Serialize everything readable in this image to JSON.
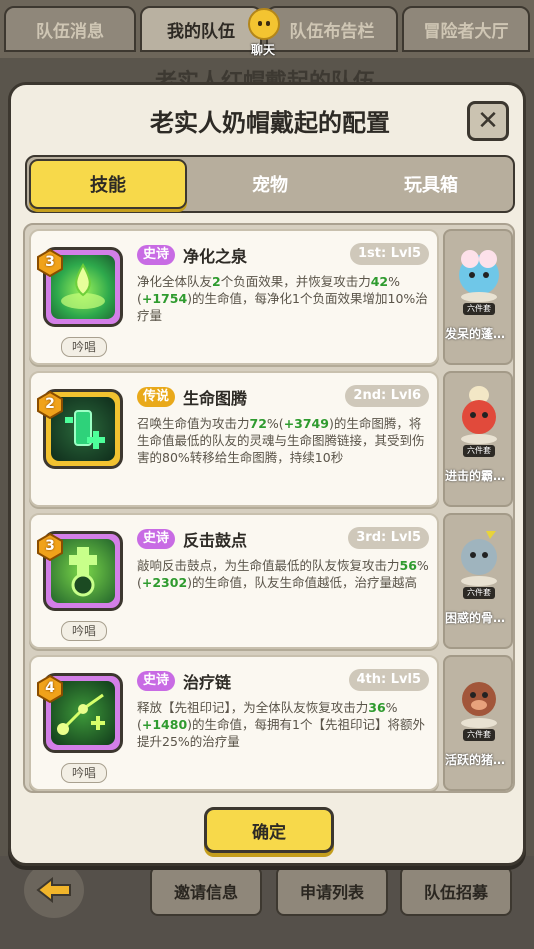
{
  "top_tabs": [
    "队伍消息",
    "我的队伍",
    "队伍布告栏",
    "冒险者大厅"
  ],
  "chat_label": "聊天",
  "background_title": "老实人红帽戴起的队伍",
  "modal": {
    "title": "老实人奶帽戴起的配置",
    "close_symbol": "✕",
    "tabs": [
      "技能",
      "宠物",
      "玩具箱"
    ],
    "active_tab": "技能",
    "confirm_label": "确定"
  },
  "skills": [
    {
      "index": "3",
      "rarity": "史诗",
      "rarity_color": "#c86be4",
      "name": "净化之泉",
      "level": "1st: Lvl5",
      "icon": "fountain-drop-icon",
      "chant": "吟唱",
      "desc_parts": [
        "净化全体队友",
        "2",
        "个负面效果，并恢复攻击力",
        "42",
        "%(",
        "+1754",
        ")的生命值，每净化1个负面效果增加10%治疗量"
      ]
    },
    {
      "index": "2",
      "rarity": "传说",
      "rarity_color": "#e9a91a",
      "name": "生命图腾",
      "level": "2nd: Lvl6",
      "icon": "totem-icon",
      "chant": "",
      "desc_parts": [
        "召唤生命值为攻击力",
        "72",
        "%(",
        "+3749",
        ")的生命图腾，将生命值最低的队友的灵魂与生命图腾链接，其受到伤害的80%转移给生命图腾，持续10秒"
      ]
    },
    {
      "index": "3",
      "rarity": "史诗",
      "rarity_color": "#c86be4",
      "name": "反击鼓点",
      "level": "3rd: Lvl5",
      "icon": "drum-icon",
      "chant": "吟唱",
      "desc_parts": [
        "敲响反击鼓点，为生命值最低的队友恢复攻击力",
        "56",
        "%(",
        "+2302",
        ")的生命值，队友生命值越低，治疗量越高"
      ]
    },
    {
      "index": "4",
      "rarity": "史诗",
      "rarity_color": "#c86be4",
      "name": "治疗链",
      "level": "4th: Lvl5",
      "icon": "heal-chain-icon",
      "chant": "吟唱",
      "desc_parts": [
        "释放【先祖印记】，为全体队友恢复攻击力",
        "36",
        "%(",
        "+1480",
        ")的生命值，每拥有1个【先祖印记】将额外提升25%的治疗量"
      ]
    }
  ],
  "pets": [
    {
      "name": "发呆的蓬…",
      "tag": "六件套",
      "icon": "fluffy-sheep-icon"
    },
    {
      "name": "进击的霸…",
      "tag": "六件套",
      "icon": "red-dragon-icon"
    },
    {
      "name": "困惑的骨…",
      "tag": "六件套",
      "icon": "bone-dragon-icon"
    },
    {
      "name": "活跃的猪…",
      "tag": "六件套",
      "icon": "boar-icon"
    }
  ],
  "bottom_buttons": [
    "邀请信息",
    "申请列表",
    "队伍招募"
  ]
}
